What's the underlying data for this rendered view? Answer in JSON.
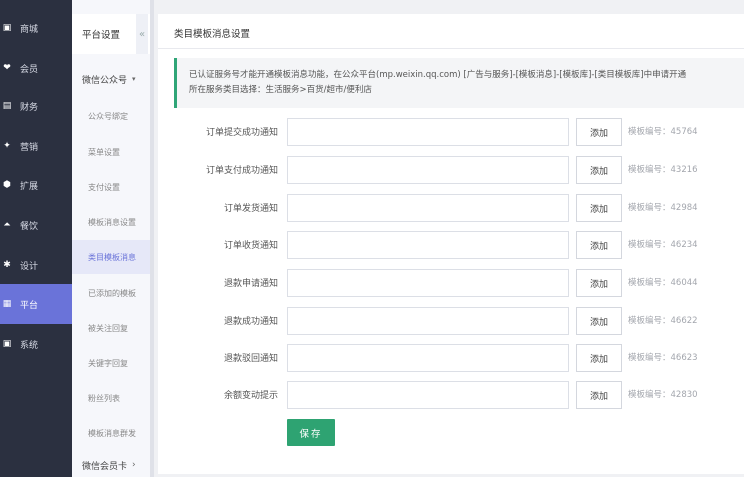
{
  "nav": [
    {
      "label": "商城",
      "icon": "shop-icon",
      "glyph": "▣"
    },
    {
      "label": "会员",
      "icon": "member-icon",
      "glyph": "❤"
    },
    {
      "label": "财务",
      "icon": "finance-icon",
      "glyph": "▤"
    },
    {
      "label": "营销",
      "icon": "megaphone-icon",
      "glyph": "✦"
    },
    {
      "label": "扩展",
      "icon": "extension-icon",
      "glyph": "⬢"
    },
    {
      "label": "餐饮",
      "icon": "dining-icon",
      "glyph": "⏶"
    },
    {
      "label": "设计",
      "icon": "design-icon",
      "glyph": "✱"
    },
    {
      "label": "平台",
      "icon": "platform-icon",
      "glyph": "▦",
      "active": true
    },
    {
      "label": "系统",
      "icon": "system-icon",
      "glyph": "▣"
    }
  ],
  "sub": {
    "title": "平台设置",
    "collapse_glyph": "«",
    "group_wechat": "微信公众号",
    "group_caret": "▾",
    "items": [
      "公众号绑定",
      "菜单设置",
      "支付设置",
      "模板消息设置",
      "类目模板消息",
      "已添加的模板",
      "被关注回复",
      "关键字回复",
      "粉丝列表",
      "模板消息群发"
    ],
    "active_index": 4,
    "group_member": "微信会员卡",
    "group_member_caret": "›"
  },
  "panel": {
    "title": "类目模板消息设置",
    "notice_line1": "已认证服务号才能开通模板消息功能，在公众平台(mp.weixin.qq.com) [广告与服务]-[模板消息]-[模板库]-[类目模板库]中申请开通",
    "notice_line2": "所在服务类目选择：生活服务>百货/超市/便利店",
    "add_label": "添加",
    "save_label": "保存",
    "rows": [
      {
        "label": "订单提交成功通知",
        "code": "模板编号：45764",
        "value": ""
      },
      {
        "label": "订单支付成功通知",
        "code": "模板编号：43216",
        "value": ""
      },
      {
        "label": "订单发货通知",
        "code": "模板编号：42984",
        "value": ""
      },
      {
        "label": "订单收货通知",
        "code": "模板编号：46234",
        "value": ""
      },
      {
        "label": "退款申请通知",
        "code": "模板编号：46044",
        "value": ""
      },
      {
        "label": "退款成功通知",
        "code": "模板编号：46622",
        "value": ""
      },
      {
        "label": "退款驳回通知",
        "code": "模板编号：46623",
        "value": ""
      },
      {
        "label": "余额变动提示",
        "code": "模板编号：42830",
        "value": ""
      }
    ]
  },
  "colors": {
    "nav_bg": "#2b3040",
    "active": "#6a73d9",
    "accent_green": "#2ea372"
  }
}
